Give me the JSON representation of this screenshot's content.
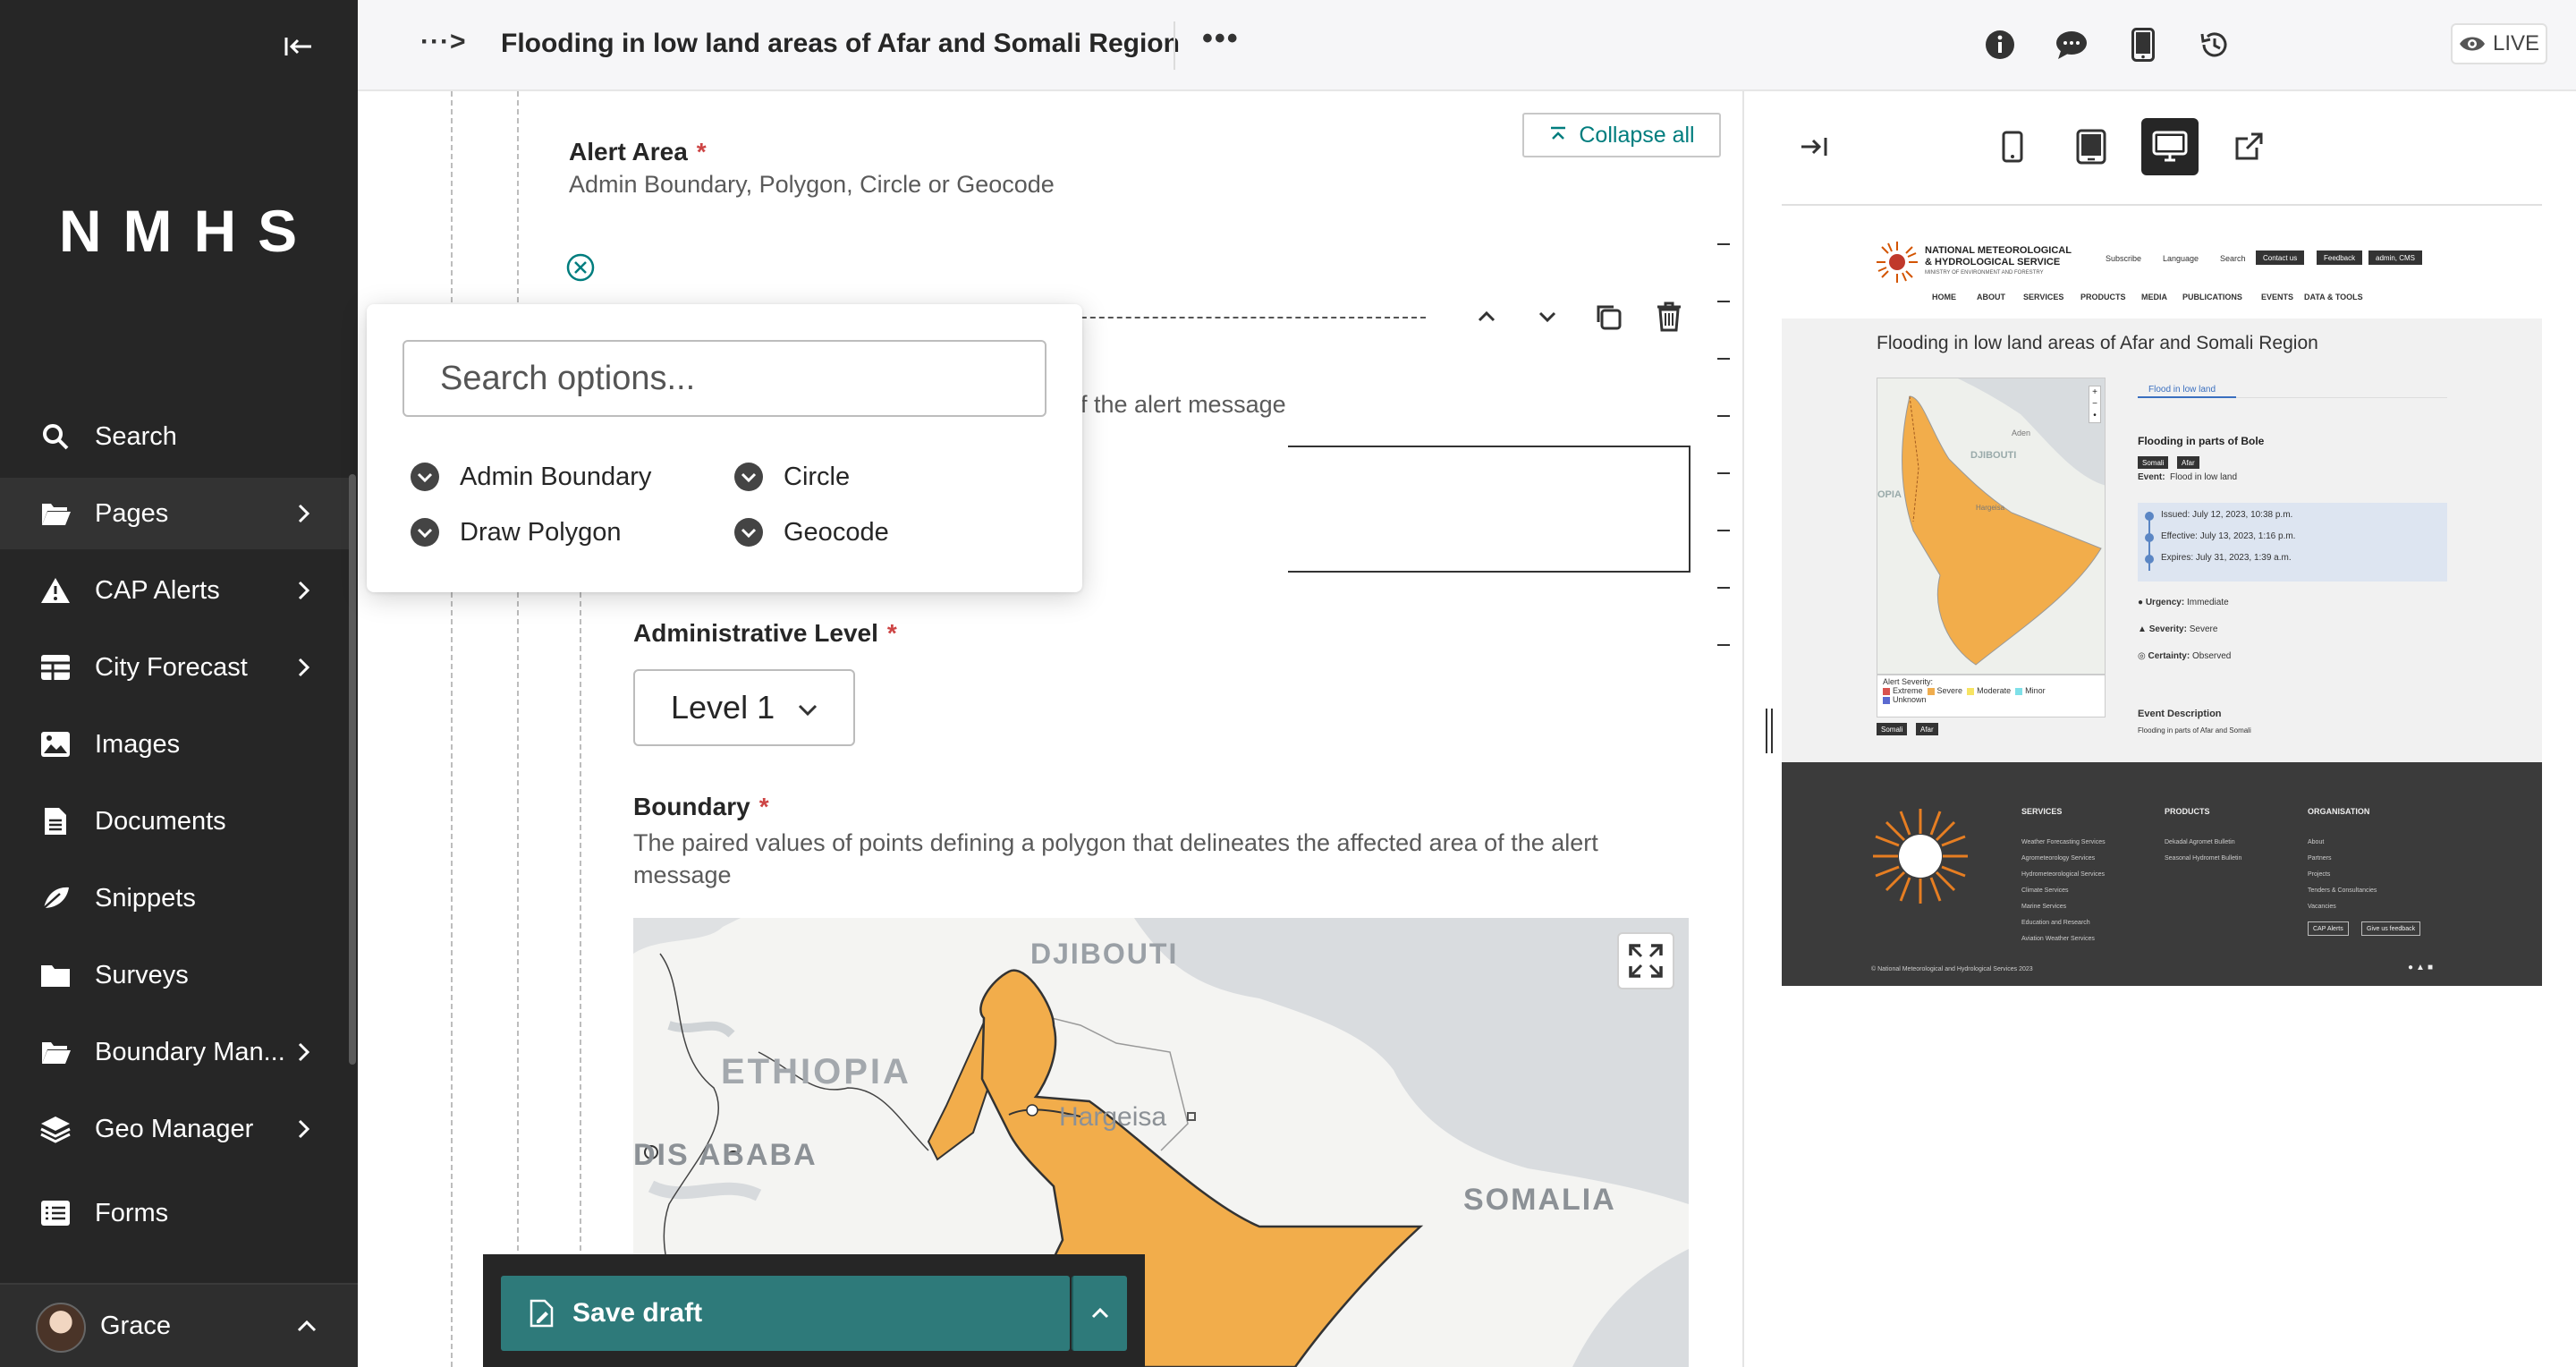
{
  "header": {
    "breadcrumb": "···>",
    "title": "Flooding in low land areas of Afar and Somali Region",
    "more": "•••",
    "live_label": "LIVE"
  },
  "sidebar": {
    "logo": "NMHS",
    "items": [
      {
        "label": "Search",
        "icon": "search-icon"
      },
      {
        "label": "Pages",
        "icon": "folder-open-icon"
      },
      {
        "label": "CAP Alerts",
        "icon": "warning-icon"
      },
      {
        "label": "City Forecast",
        "icon": "table-icon"
      },
      {
        "label": "Images",
        "icon": "image-icon"
      },
      {
        "label": "Documents",
        "icon": "document-icon"
      },
      {
        "label": "Snippets",
        "icon": "snippet-icon"
      },
      {
        "label": "Surveys",
        "icon": "folder-icon"
      },
      {
        "label": "Boundary Man...",
        "icon": "folder-open-icon"
      },
      {
        "label": "Geo Manager",
        "icon": "layers-icon"
      },
      {
        "label": "Forms",
        "icon": "list-icon"
      }
    ],
    "user": "Grace"
  },
  "editor": {
    "collapse_all": "Collapse all",
    "alert_area_label": "Alert Area",
    "alert_area_help": "Admin Boundary, Polygon, Circle or Geocode",
    "area_desc_help_partial": "f the alert message",
    "admin_level_label": "Administrative Level",
    "admin_level_value": "Level 1",
    "boundary_label": "Boundary",
    "boundary_help": "The paired values of points defining a polygon that delineates the affected area of the alert message",
    "map_labels": {
      "djibouti": "DJIBOUTI",
      "ethiopia": "ETHIOPIA",
      "addis": "DIS ABABA",
      "hargeisa": "Hargeisa",
      "somalia": "SOMALIA"
    },
    "required_mark": "*"
  },
  "dropdown": {
    "placeholder": "Search options...",
    "options": [
      "Admin Boundary",
      "Circle",
      "Draw Polygon",
      "Geocode"
    ]
  },
  "savebar": {
    "save_label": "Save draft"
  },
  "preview_site": {
    "org_name_line1": "NATIONAL METEOROLOGICAL",
    "org_name_line2": "& HYDROLOGICAL SERVICE",
    "org_sub": "MINISTRY OF ENVIRONMENT AND FORESTRY",
    "subscribe": "Subscribe",
    "language": "Language",
    "search": "Search",
    "contact_us": "Contact us",
    "feedback": "Feedback",
    "admin_cms": "admin, CMS",
    "nav": [
      "HOME",
      "ABOUT",
      "SERVICES",
      "PRODUCTS",
      "MEDIA",
      "PUBLICATIONS",
      "EVENTS",
      "DATA & TOOLS"
    ],
    "page_title": "Flooding in low land areas of Afar and Somali Region",
    "tab": "Flood in low land",
    "alert_heading": "Flooding in parts of Bole",
    "tag_somali": "Somali",
    "tag_afar": "Afar",
    "event_label": "Event:",
    "event_value": "Flood in low land",
    "issued": "Issued: July 12, 2023, 10:38 p.m.",
    "effective": "Effective: July 13, 2023, 1:16 p.m.",
    "expires": "Expires: July 31, 2023, 1:39 a.m.",
    "urgency_label": "Urgency:",
    "urgency_value": "Immediate",
    "severity_label": "Severity:",
    "severity_value": "Severe",
    "certainty_label": "Certainty:",
    "certainty_value": "Observed",
    "event_desc_heading": "Event Description",
    "event_desc": "Flooding in parts of Afar and Somali",
    "legend_title": "Alert Severity:",
    "legend": [
      {
        "label": "Extreme",
        "color": "#d9534f"
      },
      {
        "label": "Severe",
        "color": "#f0ad4e"
      },
      {
        "label": "Moderate",
        "color": "#f7e463"
      },
      {
        "label": "Minor",
        "color": "#7ee0e8"
      },
      {
        "label": "Unknown",
        "color": "#5b6ad0"
      }
    ],
    "minimap_labels": {
      "djibouti": "DJIBOUTI",
      "aden": "Aden",
      "opia": "OPIA",
      "hargeisa": "Hargeisa"
    },
    "footer": {
      "services_heading": "SERVICES",
      "services": [
        "Weather Forecasting Services",
        "Agrometeorology Services",
        "Hydrometeorological Services",
        "Climate Services",
        "Marine Services",
        "Education and Research",
        "Aviation Weather Services"
      ],
      "products_heading": "PRODUCTS",
      "products": [
        "Dekadal Agromet Bulletin",
        "Seasonal Hydromet Bulletin"
      ],
      "org_heading": "ORGANISATION",
      "org": [
        "About",
        "Partners",
        "Projects",
        "Tenders & Consultancies",
        "Vacancies"
      ],
      "cap_alerts": "CAP Alerts",
      "give_feedback": "Give us feedback",
      "copyright": "© National Meteorological and Hydrological Services 2023"
    }
  },
  "colors": {
    "sidebar_bg": "#262626",
    "accent_teal": "#2e7a7a",
    "link_teal": "#007d7e",
    "required_red": "#cd4444",
    "alert_area_orange": "#f2ad4b"
  }
}
